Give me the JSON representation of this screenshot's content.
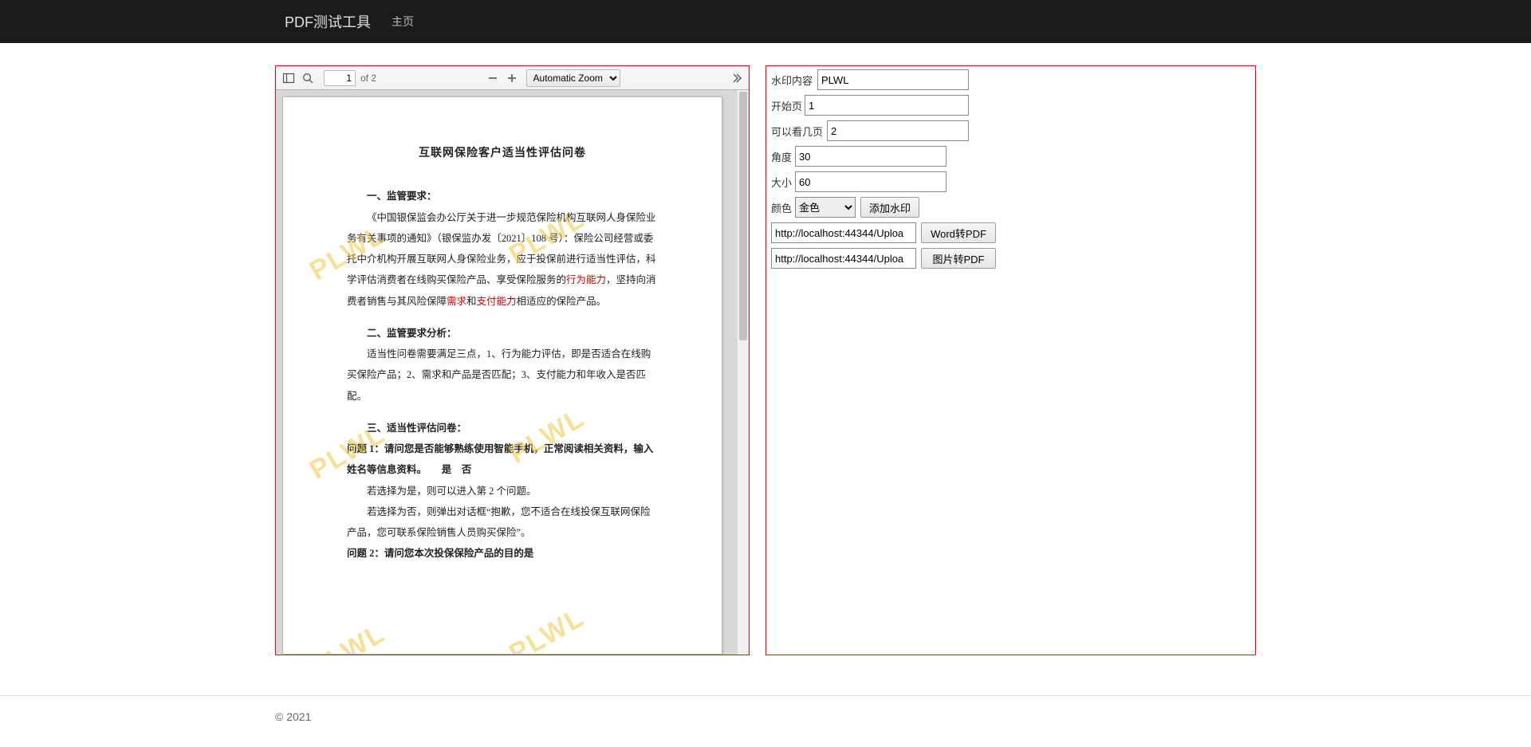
{
  "nav": {
    "brand": "PDF测试工具",
    "home": "主页"
  },
  "pdf": {
    "page_current": "1",
    "page_of": "of 2",
    "zoom_selected": "Automatic Zoom",
    "doc": {
      "title": "互联网保险客户适当性评估问卷",
      "sec1": "一、监管要求：",
      "p1a": "《中国银保监会办公厅关于进一步规范保险机构互联网人身保险业务有关事项的通知》（银保监办发〔2021〕108 号）：保险公司经营或委托中介机构开展互联网人身保险业务，应于投保前进行适当性评估，科学评估消费者在线购买保险产品、享受保险服务的",
      "p1b": "行为能力",
      "p1c": "，坚持向消费者销售与其风险保障",
      "p1d": "需求",
      "p1e": "和",
      "p1f": "支付能力",
      "p1g": "相适应的保险产品。",
      "sec2": "二、监管要求分析：",
      "p2": "适当性问卷需要满足三点，1、行为能力评估，即是否适合在线购买保险产品；2、需求和产品是否匹配；3、支付能力和年收入是否匹配。",
      "sec3": "三、适当性评估问卷：",
      "q1": "问题 1：请问您是否能够熟练使用智能手机，正常阅读相关资料，输入姓名等信息资料。　　是　否",
      "q1a": "若选择为是，则可以进入第 2 个问题。",
      "q1b": "若选择为否，则弹出对话框“抱歉，您不适合在线投保互联网保险产品，您可联系保险销售人员购买保险”。",
      "q2": "问题 2：请问您本次投保保险产品的目的是",
      "watermark_text": "PLWL"
    }
  },
  "form": {
    "labels": {
      "wm_content": "水印内容",
      "start_page": "开始页",
      "pages_visible": "可以看几页",
      "angle": "角度",
      "size": "大小",
      "color": "颜色"
    },
    "values": {
      "wm_content": "PLWL",
      "start_page": "1",
      "pages_visible": "2",
      "angle": "30",
      "size": "60",
      "color_selected": "金色",
      "url1": "http://localhost:44344/Uploa",
      "url2": "http://localhost:44344/Uploa"
    },
    "buttons": {
      "add_wm": "添加水印",
      "word_to_pdf": "Word转PDF",
      "img_to_pdf": "图片转PDF"
    }
  },
  "footer": {
    "copyright": "© 2021"
  }
}
